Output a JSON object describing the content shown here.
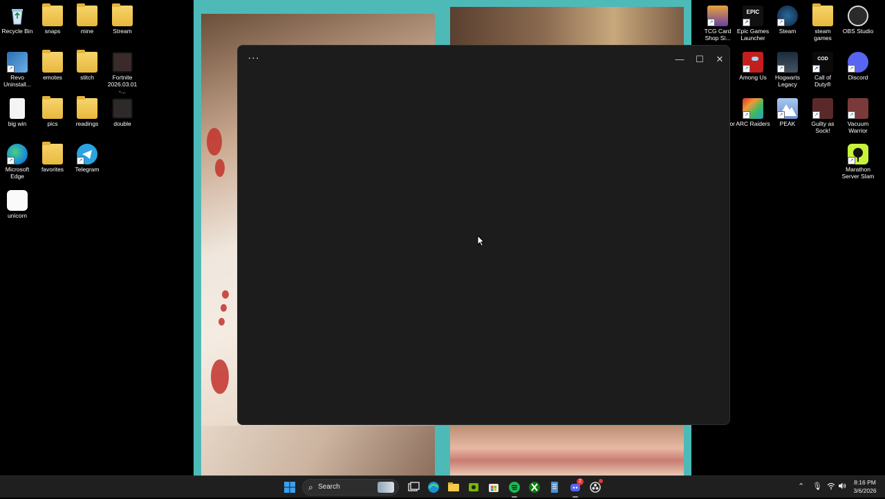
{
  "desktop_left": [
    {
      "label": "Recycle Bin",
      "icon": "recycle-bin-icon"
    },
    {
      "label": "snaps",
      "icon": "folder-icon"
    },
    {
      "label": "mine",
      "icon": "folder-icon"
    },
    {
      "label": "Stream",
      "icon": "folder-icon"
    },
    {
      "label": "Revo Uninstall...",
      "icon": "revo-uninstaller-icon"
    },
    {
      "label": "emotes",
      "icon": "folder-icon"
    },
    {
      "label": "stitch",
      "icon": "folder-icon"
    },
    {
      "label": "Fortnite 2026.03.01 -...",
      "icon": "video-file-icon"
    },
    {
      "label": "big win",
      "icon": "blank-file-icon"
    },
    {
      "label": "pics",
      "icon": "folder-icon"
    },
    {
      "label": "readings",
      "icon": "folder-icon"
    },
    {
      "label": "double",
      "icon": "video-file-icon"
    },
    {
      "label": "Microsoft Edge",
      "icon": "edge-icon"
    },
    {
      "label": "favorites",
      "icon": "folder-icon"
    },
    {
      "label": "Telegram",
      "icon": "telegram-icon"
    },
    {
      "label": "unicorn",
      "icon": "unicorn-image-icon"
    }
  ],
  "desktop_right": [
    {
      "label": "TCG Card Shop Si...",
      "icon": "tcg-card-shop-icon"
    },
    {
      "label": "Epic Games Launcher",
      "icon": "epic-games-icon"
    },
    {
      "label": "Steam",
      "icon": "steam-icon"
    },
    {
      "label": "steam games",
      "icon": "folder-icon"
    },
    {
      "label": "OBS Studio",
      "icon": "obs-icon"
    },
    {
      "label": "Among Us",
      "icon": "among-us-icon"
    },
    {
      "label": "Hogwarts Legacy",
      "icon": "hogwarts-legacy-icon"
    },
    {
      "label": "Call of Duty®",
      "icon": "call-of-duty-icon"
    },
    {
      "label": "Discord",
      "icon": "discord-icon"
    },
    {
      "label": "ARC Raiders",
      "icon": "arc-raiders-icon"
    },
    {
      "label": "PEAK",
      "icon": "peak-icon"
    },
    {
      "label": "Guilty as Sock!",
      "icon": "guilty-as-sock-icon"
    },
    {
      "label": "Vacuum Warrior",
      "icon": "vacuum-warrior-icon"
    },
    {
      "label": "Marathon Server Slam",
      "icon": "marathon-icon"
    }
  ],
  "partial_label": "or",
  "window": {
    "menu_label": "···",
    "minimize": "—",
    "maximize": "☐",
    "close": "✕"
  },
  "taskbar": {
    "search_label": "Search",
    "pinned": [
      "start-icon",
      "search-icon",
      "copilot-icon",
      "task-view-icon",
      "edge-icon",
      "file-explorer-icon",
      "nvidia-icon",
      "store-icon",
      "spotify-icon",
      "xbox-icon",
      "notepad-icon",
      "discord-icon",
      "obs-icon"
    ],
    "discord_badge": "2",
    "time": "8:16 PM",
    "date": "3/6/2026"
  },
  "colors": {
    "wallpaper_teal": "#4dbab8",
    "window_bg": "#1c1c1c",
    "taskbar_bg": "#1f1f1f"
  }
}
